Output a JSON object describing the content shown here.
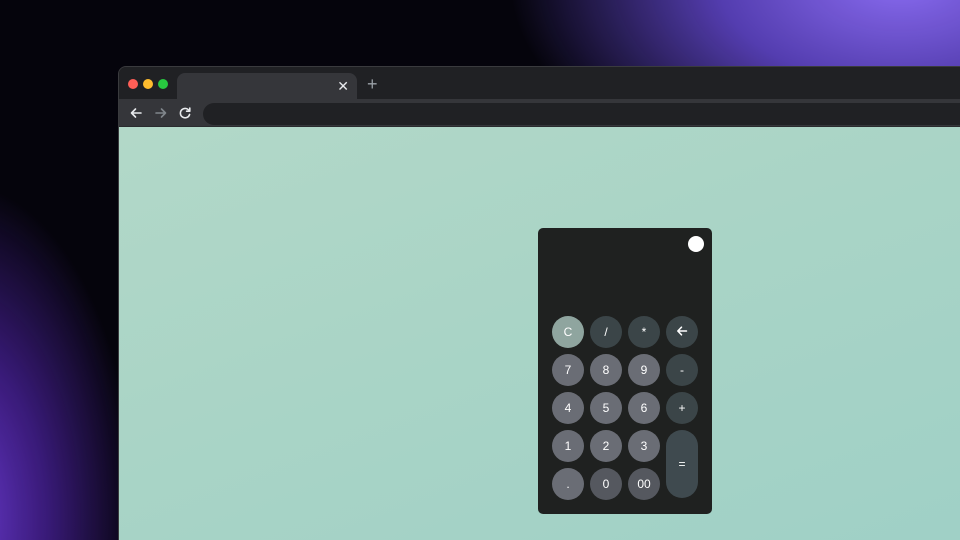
{
  "browser": {
    "tab": {
      "title": "",
      "close_label": "✕"
    },
    "new_tab_label": "+",
    "address": {
      "url": ""
    }
  },
  "calculator": {
    "display": "",
    "keys": {
      "clear": "C",
      "divide": "/",
      "multiply": "*",
      "backspace": "backspace-arrow-icon",
      "seven": "7",
      "eight": "8",
      "nine": "9",
      "subtract": "-",
      "four": "4",
      "five": "5",
      "six": "6",
      "add": "+",
      "one": "1",
      "two": "2",
      "three": "3",
      "equals": "=",
      "decimal": ".",
      "zero": "0",
      "double_zero": "00"
    }
  },
  "colors": {
    "page_bg_top": "#b2d8c8",
    "page_bg_bottom": "#9fd0c6",
    "calc_body": "#1f2120",
    "key_clear": "#8fa59f",
    "key_operator": "#3b4548",
    "key_number": "#6a6d75"
  }
}
